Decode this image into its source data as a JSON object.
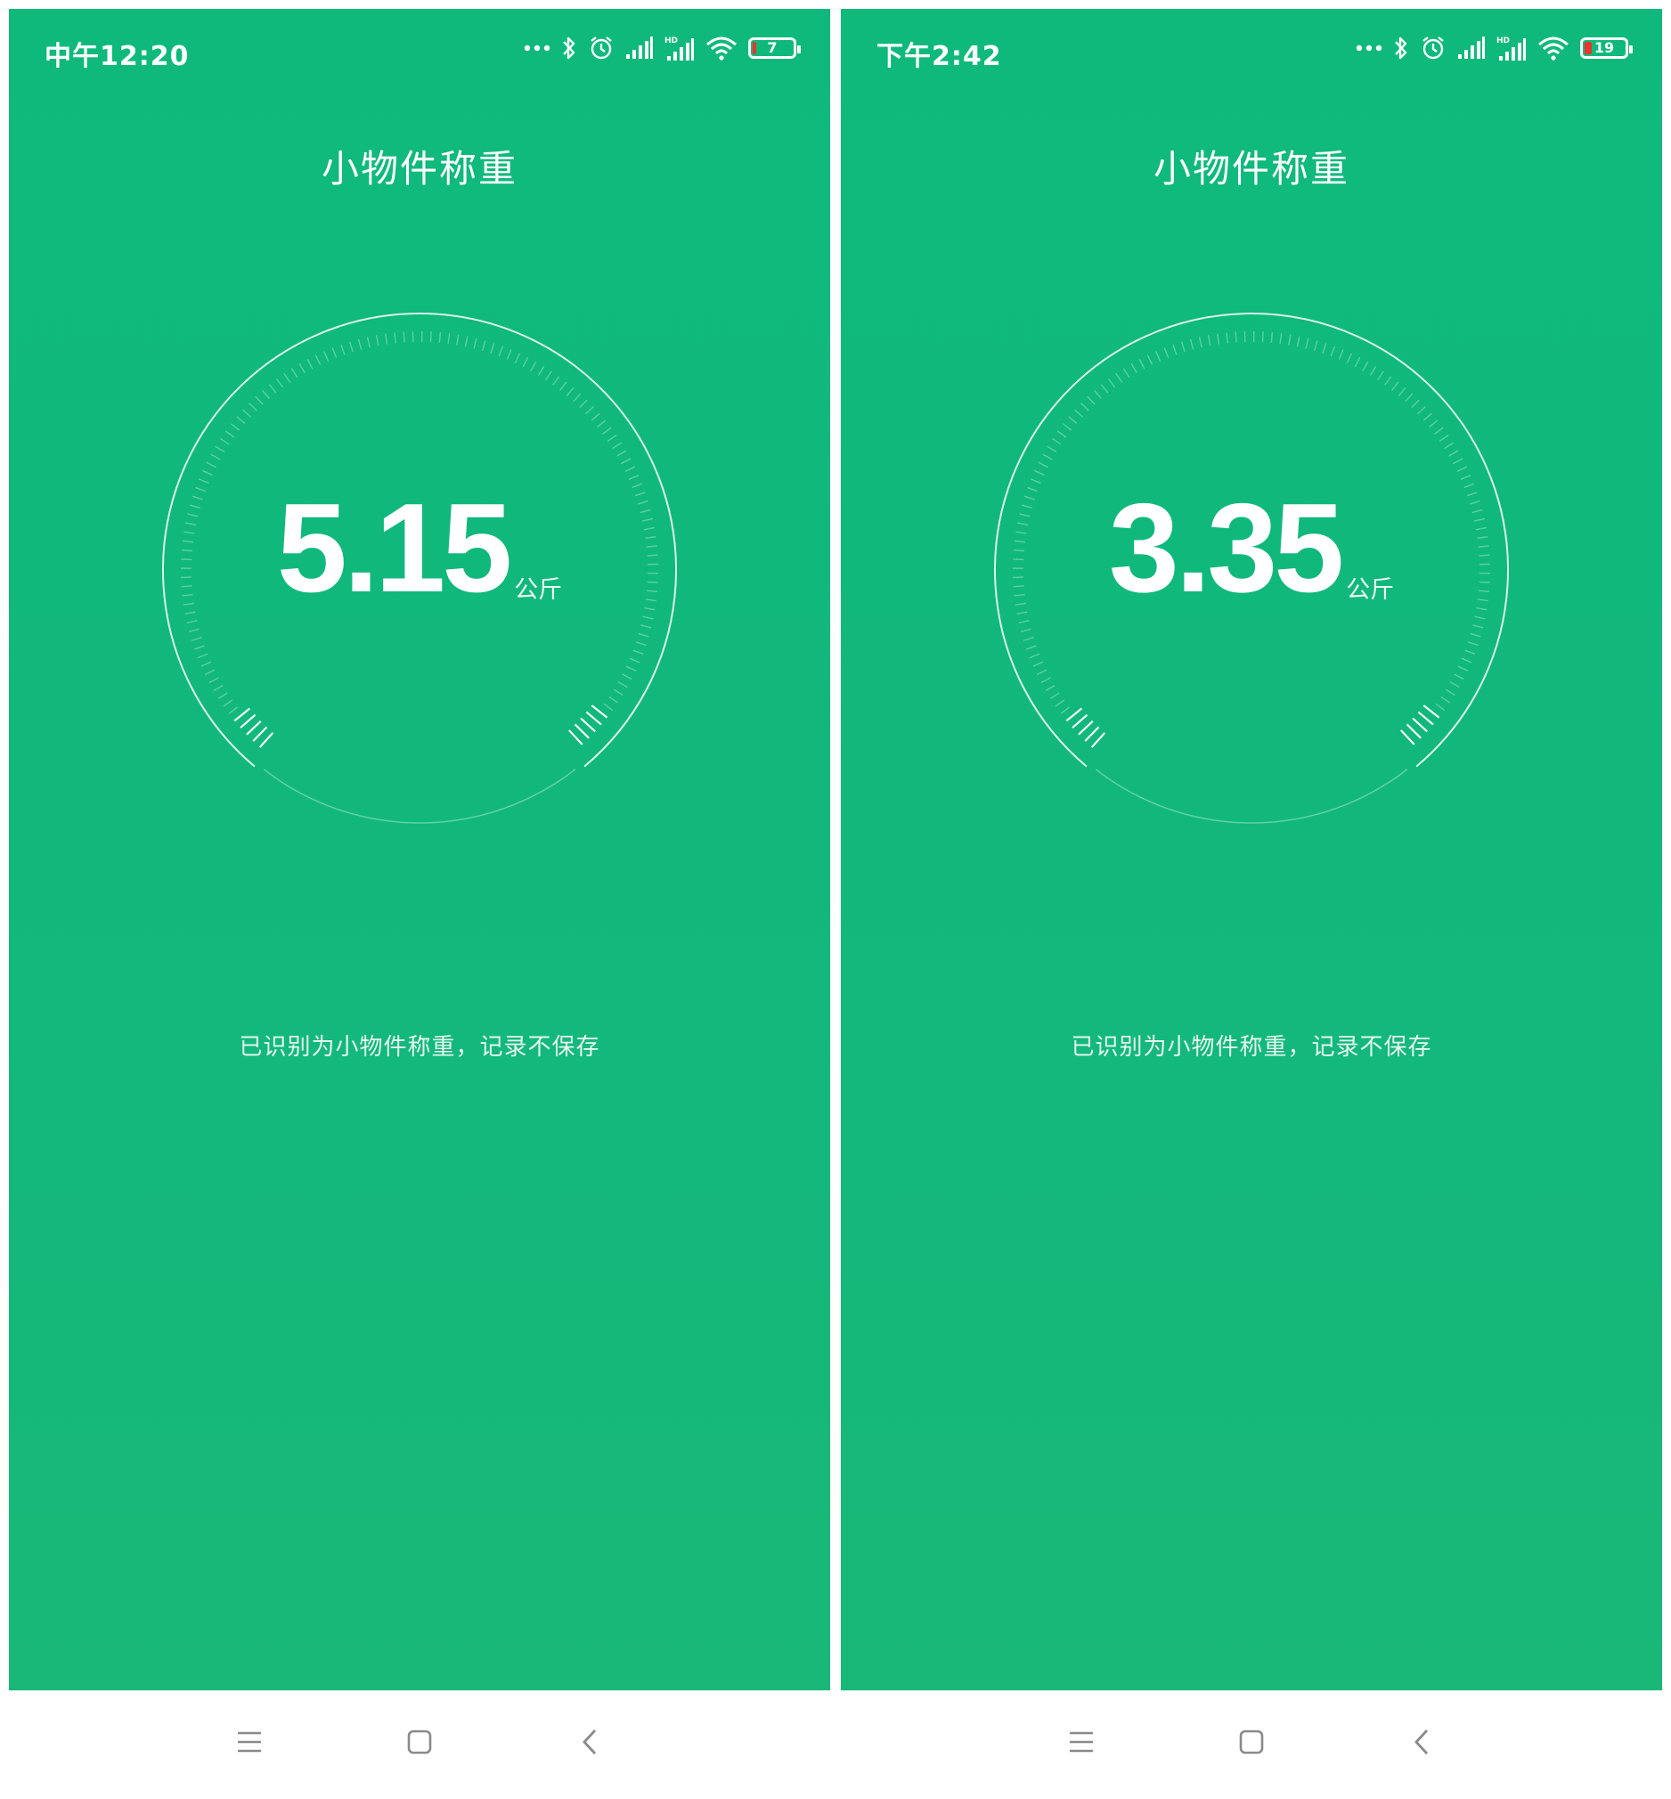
{
  "phones": [
    {
      "status_bar": {
        "time": "中午12:20",
        "battery_level": "7",
        "battery_fill_fraction": 0.07,
        "icons": [
          "more-dots-icon",
          "bluetooth-icon",
          "alarm-icon",
          "signal-icon",
          "hd-signal-icon",
          "wifi-icon",
          "battery-icon"
        ]
      },
      "title": "小物件称重",
      "reading": {
        "value": "5.15",
        "unit": "公斤"
      },
      "hint": "已识别为小物件称重，记录不保存",
      "nav_bar": {
        "icons": [
          "menu-icon",
          "home-icon",
          "back-icon"
        ]
      }
    },
    {
      "status_bar": {
        "time": "下午2:42",
        "battery_level": "19",
        "battery_fill_fraction": 0.19,
        "icons": [
          "more-dots-icon",
          "bluetooth-icon",
          "alarm-icon",
          "signal-icon",
          "hd-signal-icon",
          "wifi-icon",
          "battery-icon"
        ]
      },
      "title": "小物件称重",
      "reading": {
        "value": "3.35",
        "unit": "公斤"
      },
      "hint": "已识别为小物件称重，记录不保存",
      "nav_bar": {
        "icons": [
          "menu-icon",
          "home-icon",
          "back-icon"
        ]
      }
    }
  ],
  "colors": {
    "background_green": "#12b87b",
    "text": "#ffffff",
    "battery_low": "#e5362f"
  }
}
